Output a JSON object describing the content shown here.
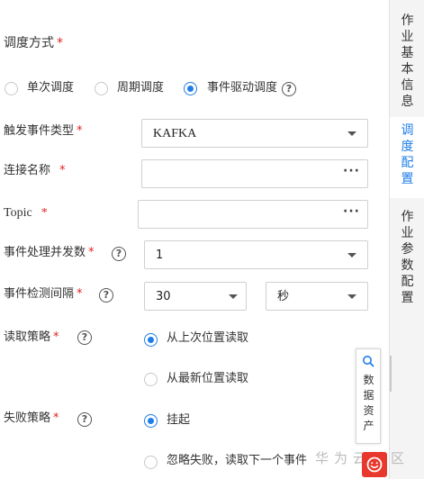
{
  "form": {
    "schedule_mode": {
      "label": "调度方式",
      "required": "*"
    },
    "schedule_options": [
      {
        "label": "单次调度",
        "selected": false
      },
      {
        "label": "周期调度",
        "selected": false
      },
      {
        "label": "事件驱动调度",
        "selected": true
      }
    ],
    "trigger_type": {
      "label": "触发事件类型",
      "required": "*",
      "value": "KAFKA"
    },
    "connection_name": {
      "label": "连接名称",
      "required": "*",
      "value": "",
      "more": "···"
    },
    "topic": {
      "label": "Topic",
      "required": "*",
      "value": "",
      "more": "···"
    },
    "concurrency": {
      "label": "事件处理并发数",
      "required": "*",
      "value": "1"
    },
    "detect_interval": {
      "label": "事件检测间隔",
      "required": "*",
      "value": "30",
      "unit": "秒"
    },
    "read_policy": {
      "label": "读取策略",
      "required": "*",
      "options": [
        {
          "label": "从上次位置读取",
          "selected": true
        },
        {
          "label": "从最新位置读取",
          "selected": false
        }
      ]
    },
    "fail_policy": {
      "label": "失败策略",
      "required": "*",
      "options": [
        {
          "label": "挂起",
          "selected": true
        },
        {
          "label": "忽略失败，读取下一个事件",
          "selected": false
        }
      ]
    },
    "help_glyph": "?"
  },
  "side_tabs": [
    {
      "label": "作业基本信息",
      "active": false
    },
    {
      "label": "调度配置",
      "active": true
    },
    {
      "label": "作业参数配置",
      "active": false
    }
  ],
  "float_panel": {
    "label": "数据资产"
  },
  "watermark": "华为云社区",
  "colors": {
    "accent": "#1e7ee8",
    "required": "#e02020",
    "float_red": "#e8382d"
  }
}
